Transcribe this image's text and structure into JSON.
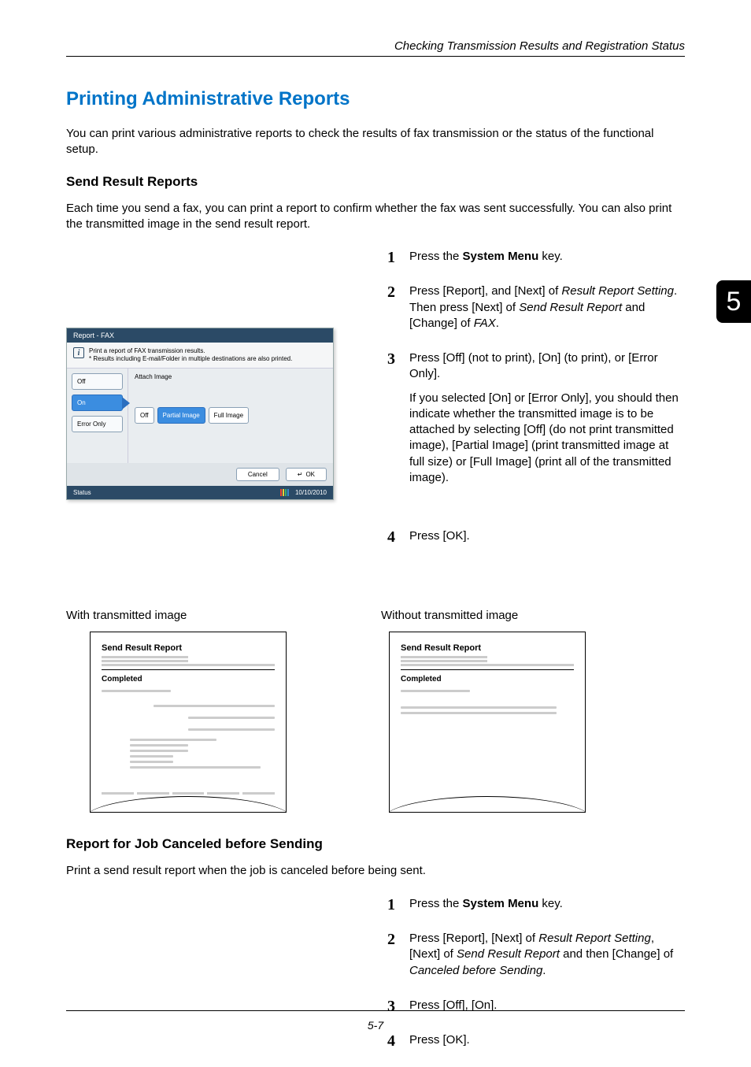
{
  "header": {
    "text": "Checking Transmission Results and Registration Status"
  },
  "tab": {
    "label": "5"
  },
  "h1": "Printing Administrative Reports",
  "intro": "You can print various administrative reports to check the results of fax transmission or the status of the functional setup.",
  "srr": {
    "heading": "Send Result Reports",
    "text": "Each time you send a fax, you can print a report to confirm whether the fax was sent successfully. You can also print the transmitted image in the send result report."
  },
  "panel": {
    "title": "Report - FAX",
    "info_line1": "Print a report of FAX transmission results.",
    "info_line2": "* Results including E-mail/Folder in multiple destinations are also printed.",
    "side": {
      "off": "Off",
      "on": "On",
      "error": "Error Only"
    },
    "main_label": "Attach Image",
    "opts": {
      "off": "Off",
      "partial": "Partial Image",
      "full": "Full Image"
    },
    "footer": {
      "cancel": "Cancel",
      "ok": "OK"
    },
    "status_label": "Status",
    "date": "10/10/2010"
  },
  "steps_a": {
    "s1_pre": "Press the ",
    "s1_bold": "System Menu",
    "s1_post": " key.",
    "s2_a": "Press [Report], and [Next] of ",
    "s2_i1": "Result Report Setting",
    "s2_b": ". Then press [Next] of ",
    "s2_i2": "Send Result Report",
    "s2_c": " and [Change] of ",
    "s2_i3": "FAX",
    "s2_d": ".",
    "s3_a": "Press [Off] (not to print), [On] (to print), or [Error Only].",
    "s3_b": "If you selected [On] or [Error Only], you should then indicate whether the transmitted image is to be attached by selecting [Off] (do not print transmitted image), [Partial Image] (print transmitted image at full size) or [Full Image] (print all of the transmitted image).",
    "s4": "Press [OK]."
  },
  "captions": {
    "left": "With transmitted image",
    "right": "Without transmitted image"
  },
  "thumb": {
    "title": "Send Result Report",
    "status": "Completed"
  },
  "cancel": {
    "heading": "Report for Job Canceled before Sending",
    "text": "Print a send result report when the job is canceled before being sent."
  },
  "steps_b": {
    "s1_pre": "Press the ",
    "s1_bold": "System Menu",
    "s1_post": " key.",
    "s2_a": "Press [Report], [Next] of ",
    "s2_i1": "Result Report Setting",
    "s2_b": ", [Next] of ",
    "s2_i2": "Send Result Report",
    "s2_c": " and then [Change] of ",
    "s2_i3": "Canceled before Sending",
    "s2_d": ".",
    "s3": "Press [Off], [On].",
    "s4": "Press [OK]."
  },
  "page_footer": "5-7"
}
